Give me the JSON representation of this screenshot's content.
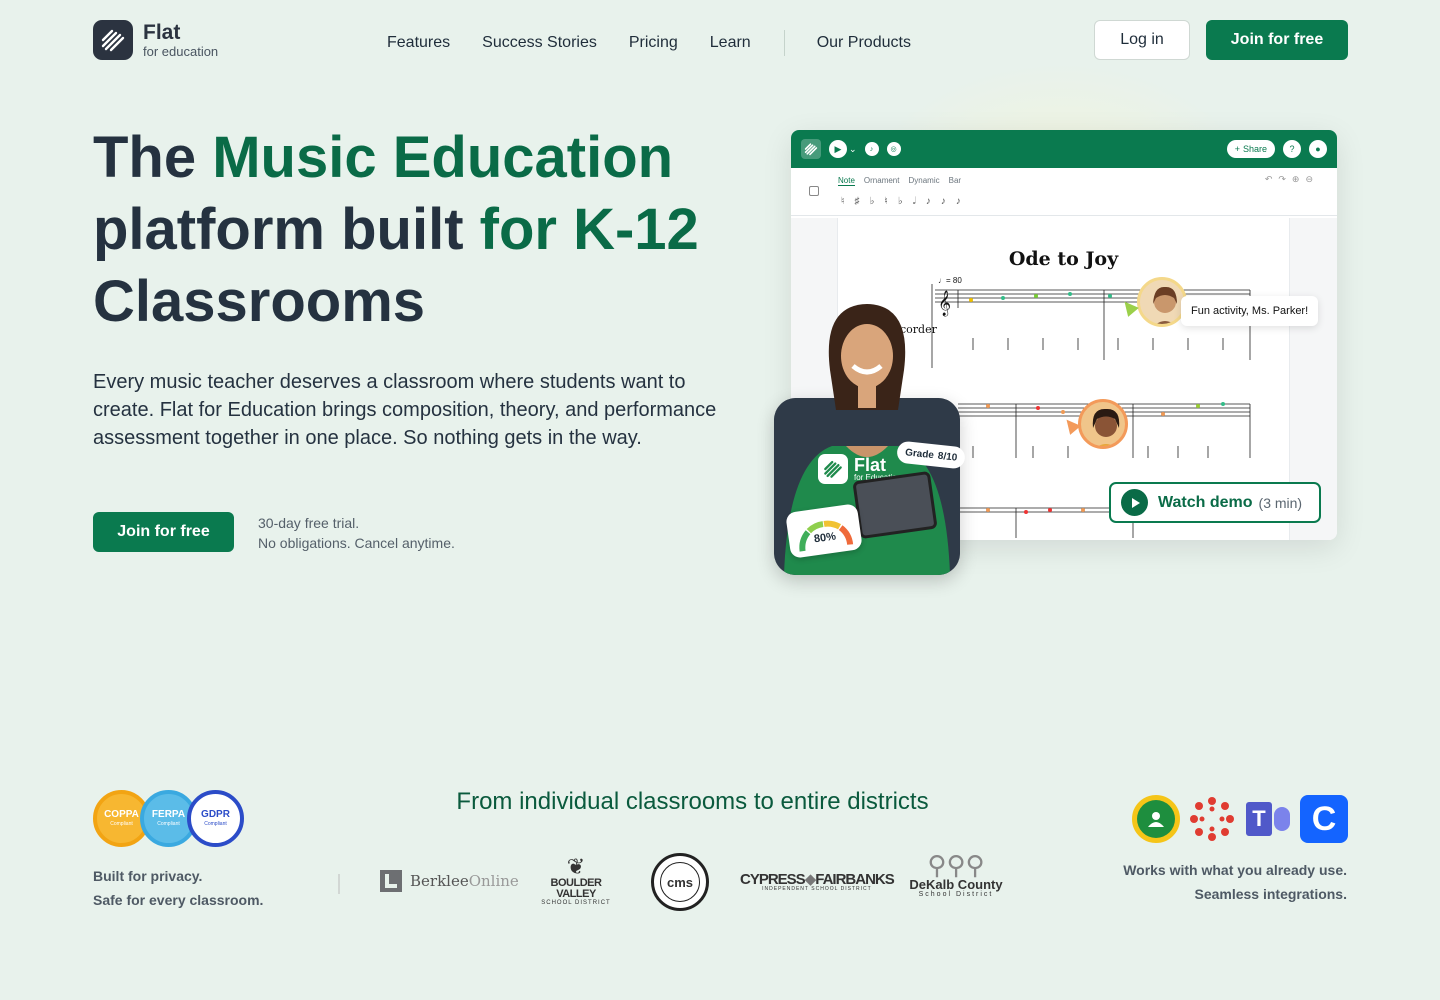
{
  "brand": {
    "name": "Flat",
    "subtitle": "for education"
  },
  "nav": {
    "links": [
      "Features",
      "Success Stories",
      "Pricing",
      "Learn"
    ],
    "products": "Our Products",
    "login": "Log in",
    "join": "Join for free"
  },
  "hero": {
    "title_part1": "The ",
    "title_highlight1": "Music Education",
    "title_part2": " platform built ",
    "title_highlight2": "for K-12",
    "title_part3": " Classrooms",
    "description": "Every music teacher deserves a classroom where students want to create. Flat for Education brings composition, theory, and performance assessment together in one place. So nothing gets in the way.",
    "cta": "Join for free",
    "trial_line1": "30-day free trial.",
    "trial_line2": "No obligations. Cancel anytime."
  },
  "app_mock": {
    "share": "Share",
    "tabs": [
      "Note",
      "Ornament",
      "Dynamic",
      "Bar"
    ],
    "score_title": "Ode to Joy",
    "instrument": "corder",
    "tempo": "♩= 80",
    "comment": "Fun activity, Ms. Parker!",
    "shirt_brand": "Flat",
    "shirt_sub": "for Education",
    "grade": "Grade",
    "grade_value": "8/10",
    "gauge_value": "80%",
    "gauge_percent": 80
  },
  "watch_demo": {
    "label": "Watch demo",
    "duration": "(3 min)"
  },
  "compliance": {
    "badges": [
      {
        "name": "COPPA",
        "sub": "Compliant",
        "color": "#f2a413"
      },
      {
        "name": "FERPA",
        "sub": "Compliant",
        "color": "#3aa9e0"
      },
      {
        "name": "GDPR",
        "sub": "Compliant",
        "color": "#2b4cc8"
      }
    ],
    "line1": "Built for privacy.",
    "line2": "Safe for every classroom."
  },
  "districts": {
    "title": "From individual classrooms to entire districts",
    "logos": [
      {
        "name": "Berklee",
        "suffix": "Online"
      },
      {
        "name": "BOULDER VALLEY",
        "sub": "SCHOOL DISTRICT"
      },
      {
        "name": "cms"
      },
      {
        "name": "CYPRESS",
        "name2": "FAIRBANKS",
        "sub": "INDEPENDENT SCHOOL DISTRICT"
      },
      {
        "name": "DeKalb County",
        "sub": "School District"
      }
    ]
  },
  "integrations": {
    "icons": [
      "google-classroom-icon",
      "canvas-icon",
      "teams-icon",
      "clever-icon"
    ],
    "clever_letter": "C",
    "teams_letter": "T",
    "line1": "Works with what you already use.",
    "line2": "Seamless integrations."
  }
}
